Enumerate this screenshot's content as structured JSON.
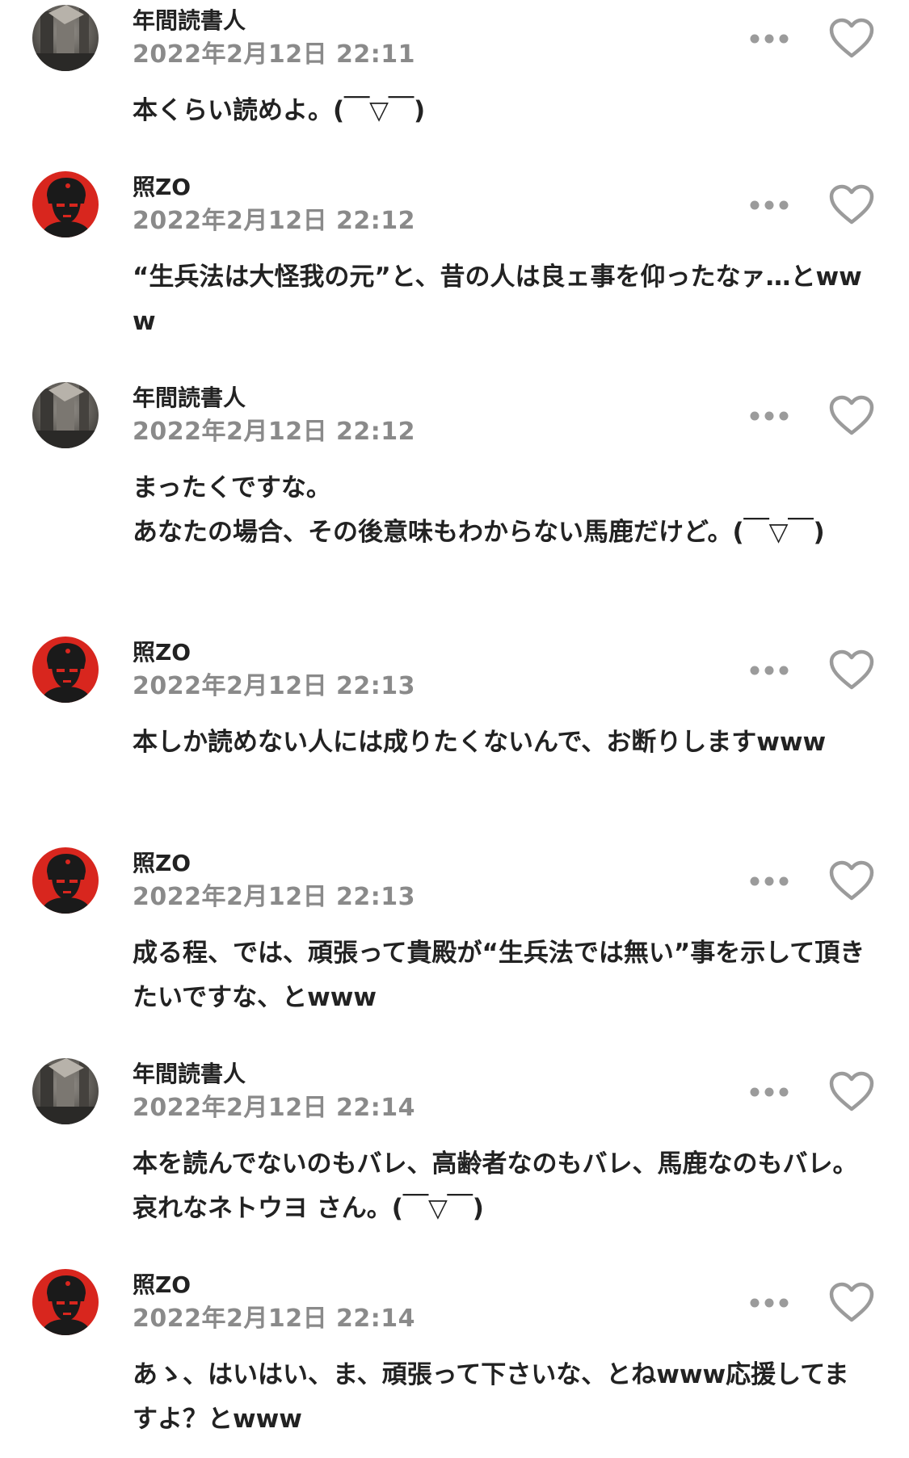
{
  "colors": {
    "text": "#222222",
    "timestamp": "#8a8a8a",
    "icon": "#9b9b9b",
    "avatar_red": "#d8261e"
  },
  "icons": {
    "more": "more-dots-icon",
    "like": "heart-outline-icon"
  },
  "comments": [
    {
      "avatar": "photo",
      "username": "年間読書人",
      "timestamp": "2022年2月12日 22:11",
      "text": "本くらい読めよ。(￣▽￣)"
    },
    {
      "avatar": "red",
      "username": "照ZO",
      "timestamp": "2022年2月12日 22:12",
      "text": "“生兵法は大怪我の元”と、昔の人は良ェ事を仰ったなァ…とwww"
    },
    {
      "avatar": "photo",
      "username": "年間読書人",
      "timestamp": "2022年2月12日 22:12",
      "text": "まったくですな。\nあなたの場合、その後意味もわからない馬鹿だけど。(￣▽￣)"
    },
    {
      "avatar": "red",
      "username": "照ZO",
      "timestamp": "2022年2月12日 22:13",
      "text": "本しか読めない人には成りたくないんで、お断りしますwww"
    },
    {
      "avatar": "red",
      "username": "照ZO",
      "timestamp": "2022年2月12日 22:13",
      "text": "成る程、では、頑張って貴殿が“生兵法では無い”事を示して頂きたいですな、とwww"
    },
    {
      "avatar": "photo",
      "username": "年間読書人",
      "timestamp": "2022年2月12日 22:14",
      "text": "本を読んでないのもバレ、高齢者なのもバレ、馬鹿なのもバレ。哀れなネトウヨ さん。(￣▽￣)"
    },
    {
      "avatar": "red",
      "username": "照ZO",
      "timestamp": "2022年2月12日 22:14",
      "text": "あゝ、はいはい、ま、頑張って下さいな、とねwww応援してますよ？とwww"
    }
  ]
}
